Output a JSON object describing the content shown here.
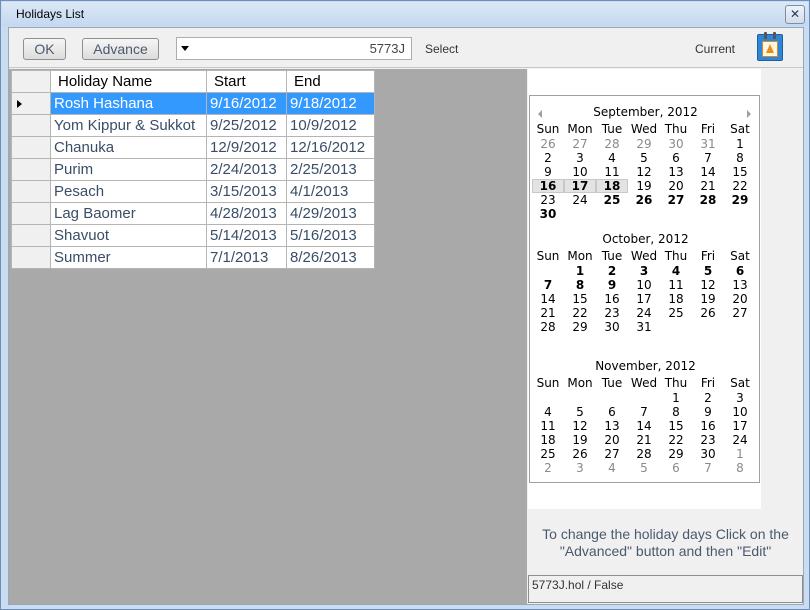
{
  "window": {
    "title": "Holidays List",
    "close_glyph": "✕"
  },
  "toolbar": {
    "ok_label": "OK",
    "advance_label": "Advance",
    "combo_value": "5773J",
    "select_label": "Select",
    "current_label": "Current"
  },
  "grid": {
    "headers": [
      "Holiday Name",
      "Start",
      "End"
    ],
    "rows": [
      {
        "name": "Rosh Hashana",
        "start": "9/16/2012",
        "end": "9/18/2012"
      },
      {
        "name": "Yom Kippur & Sukkot",
        "start": "9/25/2012",
        "end": "10/9/2012"
      },
      {
        "name": "Chanuka",
        "start": "12/9/2012",
        "end": "12/16/2012"
      },
      {
        "name": "Purim",
        "start": "2/24/2013",
        "end": "2/25/2013"
      },
      {
        "name": "Pesach",
        "start": "3/15/2013",
        "end": "4/1/2013"
      },
      {
        "name": "Lag Baomer",
        "start": "4/28/2013",
        "end": "4/29/2013"
      },
      {
        "name": "Shavuot",
        "start": "5/14/2013",
        "end": "5/16/2013"
      },
      {
        "name": "Summer",
        "start": "7/1/2013",
        "end": "8/26/2013"
      }
    ],
    "selected_row": 0
  },
  "calendar": {
    "day_names": [
      "Sun",
      "Mon",
      "Tue",
      "Wed",
      "Thu",
      "Fri",
      "Sat"
    ],
    "months": [
      {
        "title": "September, 2012",
        "weeks": [
          [
            [
              "26",
              "o"
            ],
            [
              "27",
              "o"
            ],
            [
              "28",
              "o"
            ],
            [
              "29",
              "o"
            ],
            [
              "30",
              "o"
            ],
            [
              "31",
              "o"
            ],
            [
              "1",
              ""
            ]
          ],
          [
            [
              "2",
              ""
            ],
            [
              "3",
              ""
            ],
            [
              "4",
              ""
            ],
            [
              "5",
              ""
            ],
            [
              "6",
              ""
            ],
            [
              "7",
              ""
            ],
            [
              "8",
              ""
            ]
          ],
          [
            [
              "9",
              ""
            ],
            [
              "10",
              ""
            ],
            [
              "11",
              ""
            ],
            [
              "12",
              ""
            ],
            [
              "13",
              ""
            ],
            [
              "14",
              ""
            ],
            [
              "15",
              ""
            ]
          ],
          [
            [
              "16",
              "s"
            ],
            [
              "17",
              "s"
            ],
            [
              "18",
              "s"
            ],
            [
              "19",
              ""
            ],
            [
              "20",
              ""
            ],
            [
              "21",
              ""
            ],
            [
              "22",
              ""
            ]
          ],
          [
            [
              "23",
              ""
            ],
            [
              "24",
              ""
            ],
            [
              "25",
              "b"
            ],
            [
              "26",
              "b"
            ],
            [
              "27",
              "b"
            ],
            [
              "28",
              "b"
            ],
            [
              "29",
              "b"
            ]
          ],
          [
            [
              "30",
              "b"
            ]
          ]
        ]
      },
      {
        "title": "October, 2012",
        "weeks": [
          [
            [
              "",
              ""
            ],
            [
              "1",
              "b"
            ],
            [
              "2",
              "b"
            ],
            [
              "3",
              "b"
            ],
            [
              "4",
              "b"
            ],
            [
              "5",
              "b"
            ],
            [
              "6",
              "b"
            ]
          ],
          [
            [
              "7",
              "b"
            ],
            [
              "8",
              "b"
            ],
            [
              "9",
              "b"
            ],
            [
              "10",
              ""
            ],
            [
              "11",
              ""
            ],
            [
              "12",
              ""
            ],
            [
              "13",
              ""
            ]
          ],
          [
            [
              "14",
              ""
            ],
            [
              "15",
              ""
            ],
            [
              "16",
              ""
            ],
            [
              "17",
              ""
            ],
            [
              "18",
              ""
            ],
            [
              "19",
              ""
            ],
            [
              "20",
              ""
            ]
          ],
          [
            [
              "21",
              ""
            ],
            [
              "22",
              ""
            ],
            [
              "23",
              ""
            ],
            [
              "24",
              ""
            ],
            [
              "25",
              ""
            ],
            [
              "26",
              ""
            ],
            [
              "27",
              ""
            ]
          ],
          [
            [
              "28",
              ""
            ],
            [
              "29",
              ""
            ],
            [
              "30",
              ""
            ],
            [
              "31",
              ""
            ]
          ]
        ]
      },
      {
        "title": "November, 2012",
        "weeks": [
          [
            [
              "",
              ""
            ],
            [
              "",
              ""
            ],
            [
              "",
              ""
            ],
            [
              "",
              ""
            ],
            [
              "1",
              ""
            ],
            [
              "2",
              ""
            ],
            [
              "3",
              ""
            ]
          ],
          [
            [
              "4",
              ""
            ],
            [
              "5",
              ""
            ],
            [
              "6",
              ""
            ],
            [
              "7",
              ""
            ],
            [
              "8",
              ""
            ],
            [
              "9",
              ""
            ],
            [
              "10",
              ""
            ]
          ],
          [
            [
              "11",
              ""
            ],
            [
              "12",
              ""
            ],
            [
              "13",
              ""
            ],
            [
              "14",
              ""
            ],
            [
              "15",
              ""
            ],
            [
              "16",
              ""
            ],
            [
              "17",
              ""
            ]
          ],
          [
            [
              "18",
              ""
            ],
            [
              "19",
              ""
            ],
            [
              "20",
              ""
            ],
            [
              "21",
              ""
            ],
            [
              "22",
              ""
            ],
            [
              "23",
              ""
            ],
            [
              "24",
              ""
            ]
          ],
          [
            [
              "25",
              ""
            ],
            [
              "26",
              ""
            ],
            [
              "27",
              ""
            ],
            [
              "28",
              ""
            ],
            [
              "29",
              ""
            ],
            [
              "30",
              ""
            ],
            [
              "1",
              "o"
            ]
          ],
          [
            [
              "2",
              "o"
            ],
            [
              "3",
              "o"
            ],
            [
              "4",
              "o"
            ],
            [
              "5",
              "o"
            ],
            [
              "6",
              "o"
            ],
            [
              "7",
              "o"
            ],
            [
              "8",
              "o"
            ]
          ]
        ]
      }
    ]
  },
  "hint": {
    "line1": "To change the holiday days Click on the",
    "line2": "\"Advanced\" button and then \"Edit\""
  },
  "status": {
    "text": "5773J.hol / False"
  },
  "colors": {
    "selection": "#3399ff",
    "text_blue_gray": "#3a4e66"
  },
  "icons": [
    "close-icon",
    "dropdown-arrow-icon",
    "calendar-current-icon",
    "row-pointer-icon",
    "nav-prev-icon",
    "nav-next-icon"
  ]
}
